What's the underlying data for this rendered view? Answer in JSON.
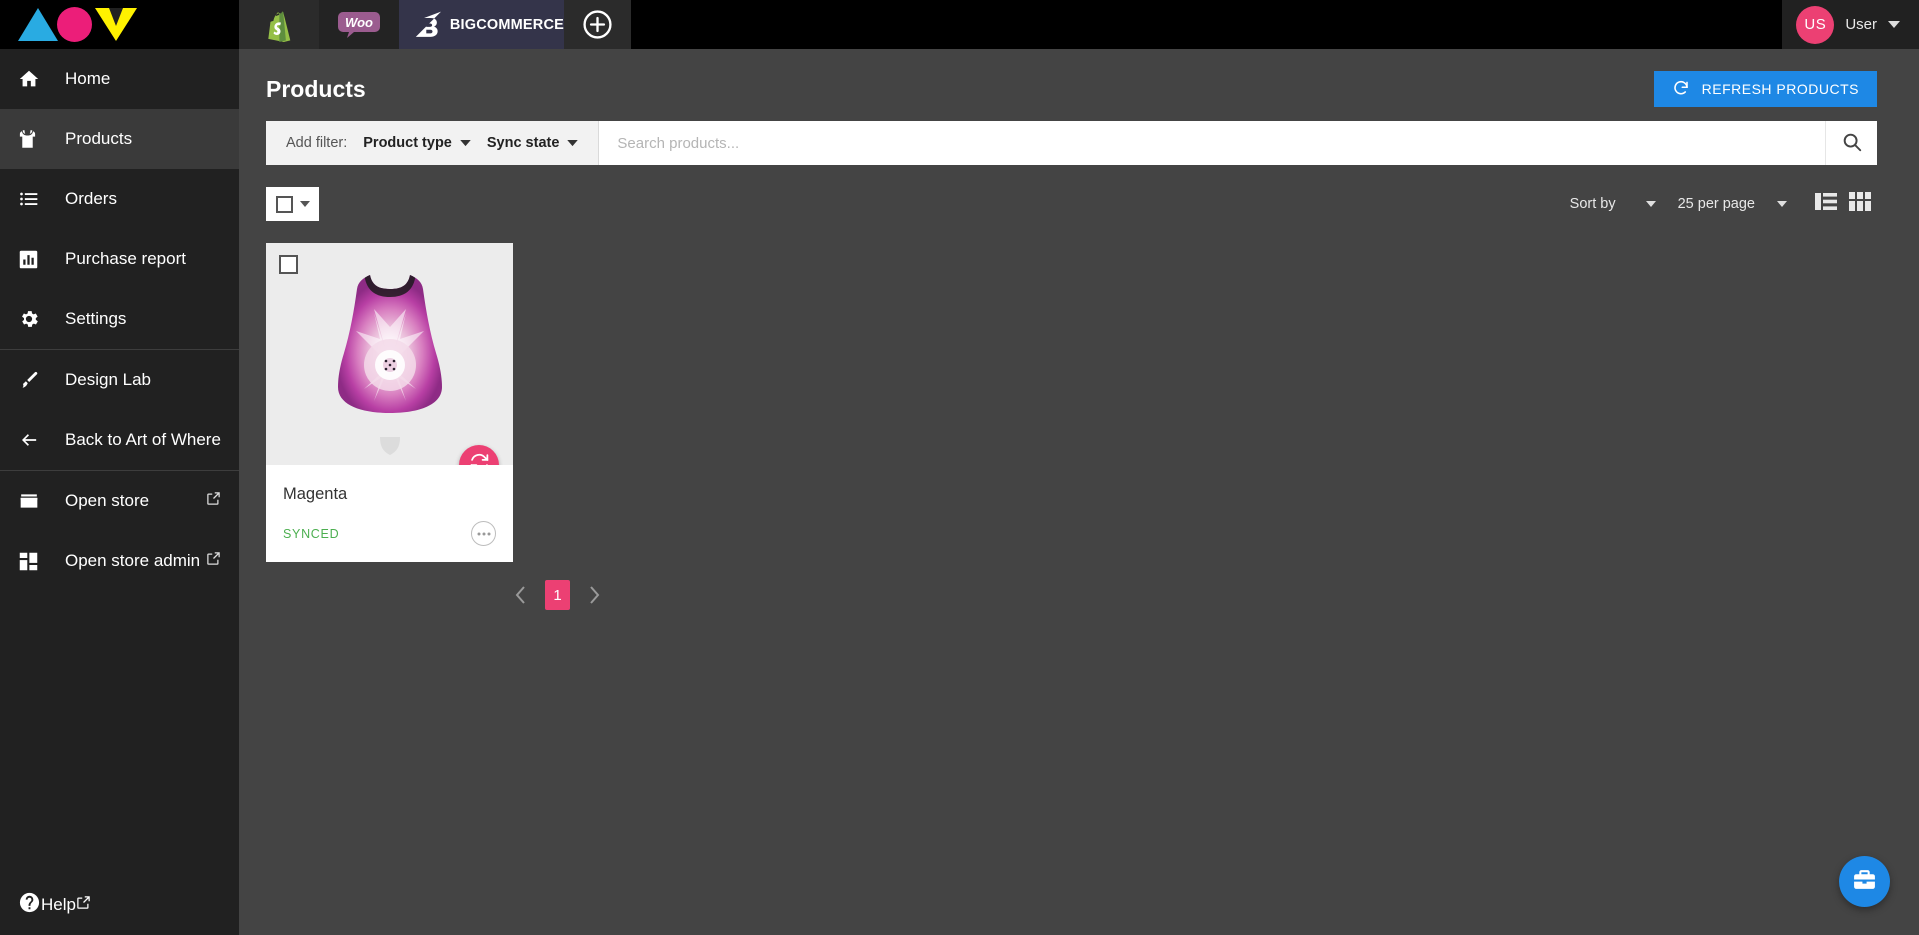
{
  "brand": {
    "logo_name": "aow-logo",
    "colors": {
      "cyan": "#29ABE2",
      "magenta": "#EC1E79",
      "yellow": "#FFF200"
    }
  },
  "topbar": {
    "store_tabs": [
      {
        "name": "shopify",
        "label": ""
      },
      {
        "name": "woocommerce",
        "label": "Woo"
      },
      {
        "name": "bigcommerce",
        "label": "BIGCOMMERCE",
        "active": true
      }
    ],
    "add_store_label": "+",
    "user": {
      "initials": "US",
      "name": "User"
    }
  },
  "sidebar": {
    "items": [
      {
        "label": "Home",
        "icon": "home-icon",
        "active": false,
        "external": false
      },
      {
        "label": "Products",
        "icon": "shirt-icon",
        "active": true,
        "external": false
      },
      {
        "label": "Orders",
        "icon": "list-icon",
        "active": false,
        "external": false
      },
      {
        "label": "Purchase report",
        "icon": "chart-icon",
        "active": false,
        "external": false
      },
      {
        "label": "Settings",
        "icon": "gear-icon",
        "active": false,
        "external": false
      },
      {
        "label": "Design Lab",
        "icon": "brush-icon",
        "active": false,
        "external": false
      },
      {
        "label": "Back to Art of Where",
        "icon": "arrow-left-icon",
        "active": false,
        "external": false
      },
      {
        "label": "Open store",
        "icon": "storefront-icon",
        "active": false,
        "external": true
      },
      {
        "label": "Open store admin",
        "icon": "dashboard-icon",
        "active": false,
        "external": true
      }
    ],
    "help": {
      "label": "Help",
      "icon": "help-icon",
      "external": true
    }
  },
  "page": {
    "title": "Products",
    "refresh_button": "REFRESH PRODUCTS"
  },
  "filters": {
    "add_filter_label": "Add filter:",
    "product_type": "Product type",
    "sync_state": "Sync state",
    "search_placeholder": "Search products...",
    "search_value": ""
  },
  "toolbar": {
    "sort_by": "Sort by",
    "per_page": "25 per page",
    "view_list": "list-view",
    "view_grid": "grid-view"
  },
  "products": [
    {
      "title": "Magenta",
      "status": "SYNCED",
      "status_color": "#4CAF50",
      "image_alt": "magenta floral tank dress",
      "selected": false
    }
  ],
  "pagination": {
    "prev": "‹",
    "pages": [
      "1"
    ],
    "current": "1",
    "next": "›"
  },
  "help_fab": {
    "name": "help-fab",
    "color": "#1e88e5"
  }
}
